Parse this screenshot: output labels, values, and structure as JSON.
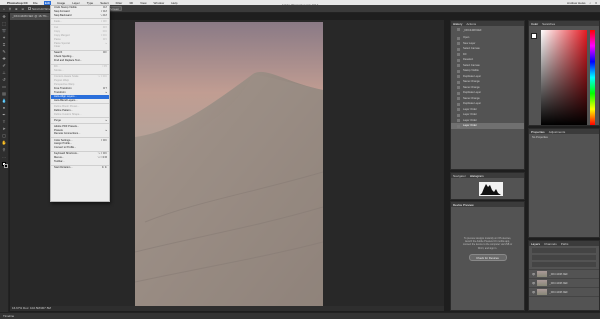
{
  "menubar": {
    "app_name": "Photoshop CC",
    "items": [
      "File",
      "Edit",
      "Image",
      "Layer",
      "Type",
      "Select",
      "Filter",
      "3D",
      "View",
      "Window",
      "Help"
    ],
    "active_item": "Edit",
    "right_text": "Andrew Heiss"
  },
  "window_title": "Adobe Photoshop CC 2017",
  "options_bar": {
    "buttons": [
      "Scroll All Windows",
      "100%",
      "Fit Screen",
      "Fill Screen"
    ]
  },
  "document_tab": "_DKC4408.NEF @ 16.7%...",
  "edit_menu": {
    "rows": [
      {
        "label": "Undo Stamp Visible",
        "shortcut": "⌘Z",
        "disabled": false
      },
      {
        "label": "Step Forward",
        "shortcut": "⇧⌘Z",
        "disabled": false
      },
      {
        "label": "Step Backward",
        "shortcut": "⌥⌘Z",
        "disabled": false
      },
      {
        "sep": true
      },
      {
        "label": "Fade...",
        "shortcut": "⇧⌘F",
        "disabled": true
      },
      {
        "sep": true
      },
      {
        "label": "Cut",
        "shortcut": "⌘X",
        "disabled": true
      },
      {
        "label": "Copy",
        "shortcut": "⌘C",
        "disabled": true
      },
      {
        "label": "Copy Merged",
        "shortcut": "⇧⌘C",
        "disabled": true
      },
      {
        "label": "Paste",
        "shortcut": "⌘V",
        "disabled": true
      },
      {
        "label": "Paste Special",
        "shortcut": "▸",
        "disabled": true
      },
      {
        "label": "Clear",
        "shortcut": "",
        "disabled": true
      },
      {
        "sep": true
      },
      {
        "label": "Search",
        "shortcut": "⌘F",
        "disabled": false
      },
      {
        "label": "Check Spelling...",
        "shortcut": "",
        "disabled": false
      },
      {
        "label": "Find and Replace Text...",
        "shortcut": "",
        "disabled": false
      },
      {
        "sep": true
      },
      {
        "label": "Fill...",
        "shortcut": "⇧F5",
        "disabled": true
      },
      {
        "label": "Stroke...",
        "shortcut": "",
        "disabled": true
      },
      {
        "sep": true
      },
      {
        "label": "Content-Aware Scale",
        "shortcut": "⌥⇧⌘C",
        "disabled": true
      },
      {
        "label": "Puppet Warp",
        "shortcut": "",
        "disabled": true
      },
      {
        "label": "Perspective Warp",
        "shortcut": "",
        "disabled": true
      },
      {
        "label": "Free Transform",
        "shortcut": "⌘T",
        "disabled": false
      },
      {
        "label": "Transform",
        "shortcut": "▸",
        "disabled": false
      },
      {
        "label": "Auto-Align Layers...",
        "shortcut": "",
        "disabled": false,
        "highlight": true
      },
      {
        "label": "Auto-Blend Layers...",
        "shortcut": "",
        "disabled": false
      },
      {
        "sep": true
      },
      {
        "label": "Define Brush Preset...",
        "shortcut": "",
        "disabled": true
      },
      {
        "label": "Define Pattern...",
        "shortcut": "",
        "disabled": false
      },
      {
        "label": "Define Custom Shape...",
        "shortcut": "",
        "disabled": true
      },
      {
        "sep": true
      },
      {
        "label": "Purge",
        "shortcut": "▸",
        "disabled": false
      },
      {
        "sep": true
      },
      {
        "label": "Adobe PDF Presets...",
        "shortcut": "",
        "disabled": false
      },
      {
        "label": "Presets",
        "shortcut": "▸",
        "disabled": false
      },
      {
        "label": "Remote Connections...",
        "shortcut": "",
        "disabled": false
      },
      {
        "sep": true
      },
      {
        "label": "Color Settings...",
        "shortcut": "⇧⌘K",
        "disabled": false
      },
      {
        "label": "Assign Profile...",
        "shortcut": "",
        "disabled": false
      },
      {
        "label": "Convert to Profile...",
        "shortcut": "",
        "disabled": false
      },
      {
        "sep": true
      },
      {
        "label": "Keyboard Shortcuts...",
        "shortcut": "⌥⇧⌘K",
        "disabled": false
      },
      {
        "label": "Menus...",
        "shortcut": "⌥⇧⌘M",
        "disabled": false
      },
      {
        "label": "Toolbar...",
        "shortcut": "",
        "disabled": false
      },
      {
        "sep": true
      },
      {
        "label": "Start Dictation...",
        "shortcut": "fn fn",
        "disabled": false
      }
    ]
  },
  "history_panel": {
    "tabs": [
      "History",
      "Actions"
    ],
    "snapshot": "_DKC4408.NEF",
    "items": [
      "Open",
      "New Layer",
      "Select Canvas",
      "Fill",
      "Deselect",
      "Select Canvas",
      "Stamp Visible",
      "Duplicate Layer",
      "Name Change",
      "Name Change",
      "Duplicate Layer",
      "Name Change",
      "Duplicate Layer",
      "Layer Order",
      "Layer Order",
      "Layer Order",
      "Layer Order"
    ],
    "current_index": 16,
    "gray_from": 17
  },
  "color_panel": {
    "tabs": [
      "Color",
      "Swatches"
    ]
  },
  "properties_panel": {
    "tabs": [
      "Properties",
      "Adjustments"
    ],
    "text": "No Properties"
  },
  "histogram_panel": {
    "tabs": [
      "Navigator",
      "Histogram"
    ]
  },
  "device_panel": {
    "title": "Device Preview",
    "message": "To preview designs instantly on iOS devices, launch the Adobe Preview CC mobile app, connect the device to the computer via USB or Wi-Fi, and sign in.",
    "button": "Check for Devices"
  },
  "layers_panel": {
    "tabs": [
      "Layers",
      "Channels",
      "Paths"
    ],
    "layers": [
      "_DKC4408.NEF",
      "_DKC4408.NEF",
      "_DKC4408.NEF"
    ]
  },
  "status_text": "16.67%     Doc: 102.5M/307.5M",
  "timeline": "Timeline"
}
